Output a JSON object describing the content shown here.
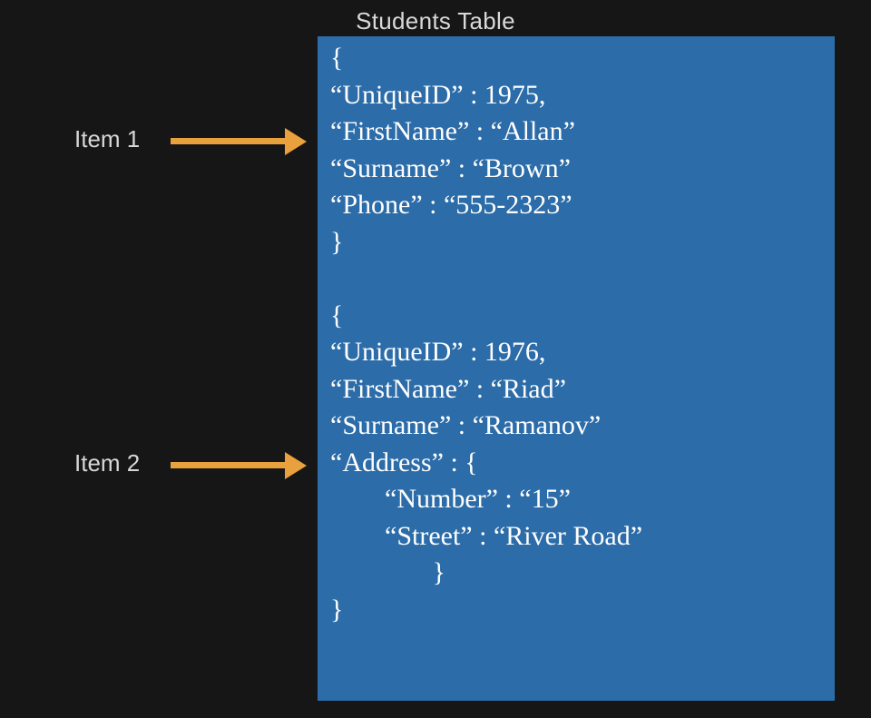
{
  "title": "Students Table",
  "labels": {
    "item1": "Item 1",
    "item2": "Item 2"
  },
  "items": [
    {
      "open": "{",
      "lines": [
        "“UniqueID” : 1975,",
        "“FirstName” : “Allan”",
        "“Surname” : “Brown”",
        "“Phone” : “555-2323”"
      ],
      "close": "}"
    },
    {
      "open": "{",
      "lines": [
        "“UniqueID” : 1976,",
        "“FirstName” : “Riad”",
        "“Surname” : “Ramanov”",
        "“Address” : {",
        "        “Number” : “15”",
        "        “Street” : “River Road”",
        "               }"
      ],
      "close": "}"
    }
  ]
}
